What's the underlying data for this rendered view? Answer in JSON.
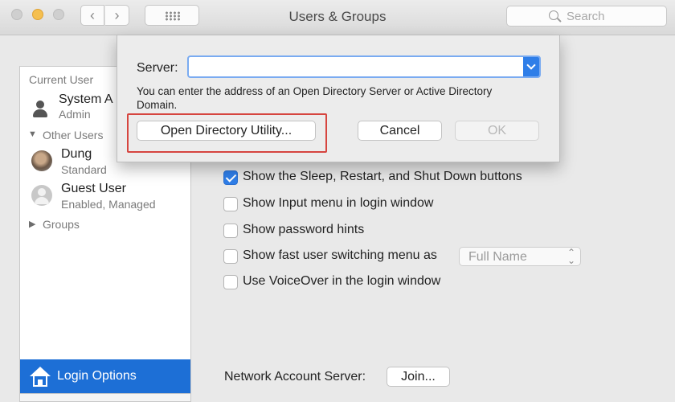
{
  "window": {
    "title": "Users & Groups"
  },
  "toolbar": {
    "back_glyph": "‹",
    "forward_glyph": "›",
    "search_placeholder": "Search",
    "icons": {
      "search": "search-icon",
      "grid": "grid-icon"
    }
  },
  "sidebar": {
    "current_user_header": "Current User",
    "current_user": {
      "name": "System A",
      "role": "Admin"
    },
    "other_users_header": "Other Users",
    "other_users": [
      {
        "name": "Dung",
        "role": "Standard"
      },
      {
        "name": "Guest User",
        "role": "Enabled, Managed"
      }
    ],
    "groups_label": "Groups",
    "login_options_label": "Login Options",
    "expanded_glyph": "▼",
    "collapsed_glyph": "▶"
  },
  "login_settings": {
    "checkboxes": [
      {
        "label": "Show the Sleep, Restart, and Shut Down buttons",
        "checked": true
      },
      {
        "label": "Show Input menu in login window",
        "checked": false
      },
      {
        "label": "Show password hints",
        "checked": false
      },
      {
        "label": "Show fast user switching menu as",
        "checked": false
      },
      {
        "label": "Use VoiceOver in the login window",
        "checked": false
      }
    ],
    "fast_user_switching_value": "Full Name",
    "network_account_server_label": "Network Account Server:",
    "join_button": "Join..."
  },
  "dialog": {
    "server_label": "Server:",
    "server_value": "",
    "hint": "You can enter the address of an Open Directory Server or Active Directory Domain.",
    "open_directory_button": "Open Directory Utility...",
    "cancel_button": "Cancel",
    "ok_button": "OK"
  },
  "colors": {
    "selection_blue": "#1d6fd6",
    "checkbox_blue": "#2f7ee8",
    "annotation_red": "#d6453f",
    "minimize_yellow": "#f5bf4f"
  }
}
